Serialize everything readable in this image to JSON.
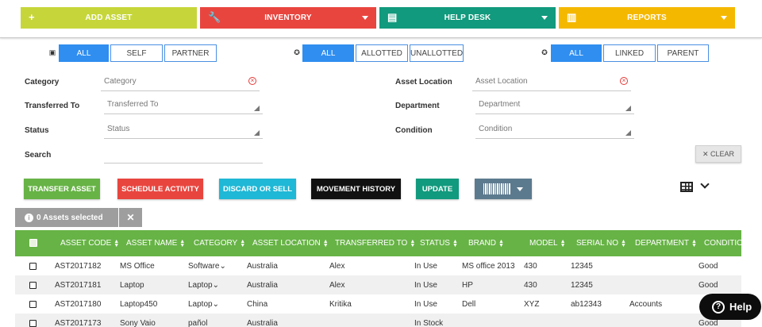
{
  "nav": {
    "add_asset": "ADD ASSET",
    "inventory": "INVENTORY",
    "help_desk": "HELP DESK",
    "reports": "REPORTS"
  },
  "segments": {
    "group1": [
      "ALL",
      "SELF",
      "PARTNER"
    ],
    "group2": [
      "ALL",
      "ALLOTTED",
      "UNALLOTTED"
    ],
    "group3": [
      "ALL",
      "LINKED",
      "PARENT"
    ]
  },
  "filters": {
    "category_label": "Category",
    "category_placeholder": "Category",
    "transferred_label": "Transferred To",
    "transferred_placeholder": "Transferred To",
    "status_label": "Status",
    "status_placeholder": "Status",
    "search_label": "Search",
    "location_label": "Asset Location",
    "location_placeholder": "Asset Location",
    "department_label": "Department",
    "department_placeholder": "Department",
    "condition_label": "Condition",
    "condition_placeholder": "Condition",
    "clear": "✕ CLEAR"
  },
  "actions": {
    "transfer": "TRANSFER ASSET",
    "schedule": "SCHEDULE ACTIVITY",
    "discard": "DISCARD OR SELL",
    "movement": "MOVEMENT HISTORY",
    "update": "UPDATE"
  },
  "selection": {
    "text": "0 Assets selected"
  },
  "table": {
    "headers": [
      "ASSET CODE",
      "ASSET NAME",
      "CATEGORY",
      "ASSET LOCATION",
      "TRANSFERRED TO",
      "STATUS",
      "BRAND",
      "MODEL",
      "SERIAL NO",
      "DEPARTMENT",
      "CONDITION"
    ],
    "rows": [
      [
        "AST2017182",
        "MS Office",
        "Software",
        "Australia",
        "Alex",
        "In Use",
        "MS office 2013",
        "430",
        "12345",
        "",
        "Good"
      ],
      [
        "AST2017181",
        "Laptop",
        "Laptop",
        "Australia",
        "Alex",
        "In Use",
        "HP",
        "430",
        "12345",
        "",
        "Good"
      ],
      [
        "AST2017180",
        "Laptop450",
        "Laptop",
        "China",
        "Kritika",
        "In Use",
        "Dell",
        "XYZ",
        "ab12343",
        "Accounts",
        ""
      ],
      [
        "AST2017173",
        "Sony Vaio",
        "pañol",
        "Australia",
        "",
        "In Stock",
        "",
        "",
        "",
        "",
        "Good"
      ]
    ]
  },
  "help": {
    "label": "Help"
  }
}
